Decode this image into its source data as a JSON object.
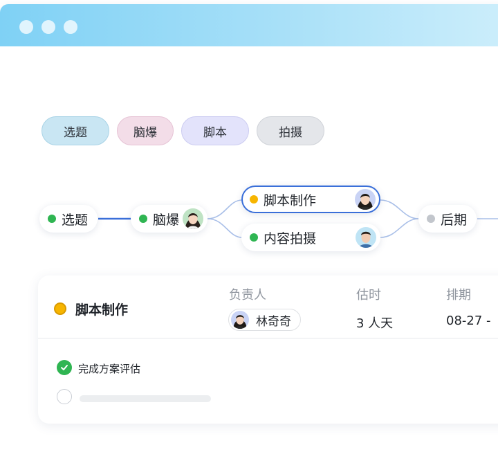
{
  "window": {
    "dots": [
      "",
      "",
      ""
    ]
  },
  "stage_tags": [
    {
      "label": "选题",
      "bg": "#c9e6f3",
      "border": "#a9d3e6"
    },
    {
      "label": "脑爆",
      "bg": "#f3dde8",
      "border": "#e6c3d5"
    },
    {
      "label": "脚本",
      "bg": "#e3e3fb",
      "border": "#ccccf1"
    },
    {
      "label": "拍摄",
      "bg": "#e4e6ea",
      "border": "#cfd2d8"
    }
  ],
  "flow": {
    "nodes": [
      {
        "label": "选题",
        "status_color": "#2fb552"
      },
      {
        "label": "脑爆",
        "status_color": "#2fb552",
        "avatar": "female-avatar"
      },
      {
        "label": "脚本制作",
        "status_color": "#f7b500",
        "avatar": "female-avatar",
        "selected": true
      },
      {
        "label": "内容拍摄",
        "status_color": "#2fb552",
        "avatar": "male-avatar"
      },
      {
        "label": "后期",
        "status_color": "#c2c6cc"
      }
    ]
  },
  "detail": {
    "title": "脚本制作",
    "status_color": "#f7b500",
    "headers": {
      "owner": "负责人",
      "estimate": "估时",
      "schedule": "排期"
    },
    "owner_name": "林奇奇",
    "estimate_value": "3 人天",
    "schedule_value": "08-27 -",
    "tasks": [
      {
        "label": "完成方案评估",
        "done": true
      },
      {
        "label": "",
        "done": false
      }
    ]
  },
  "colors": {
    "accent": "#3a6fd9",
    "done": "#2fb552",
    "in_progress": "#f7b500",
    "pending": "#c2c6cc"
  }
}
